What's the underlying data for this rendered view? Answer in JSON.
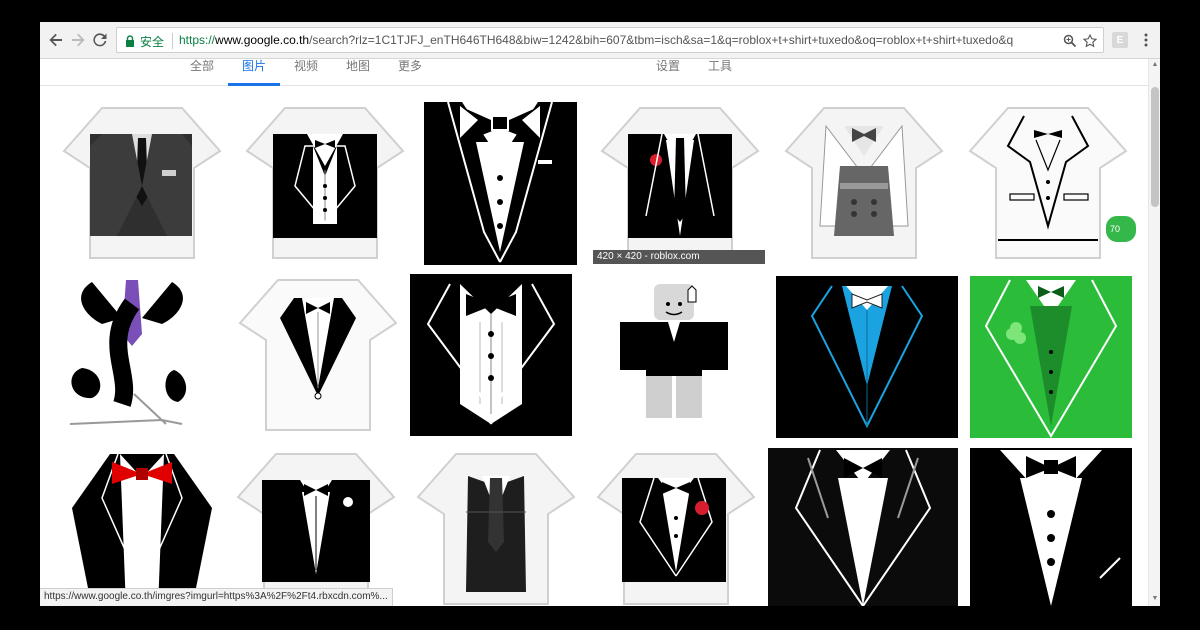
{
  "browser": {
    "secure_label": "安全",
    "url_scheme": "https://",
    "url_host": "www.google.co.th",
    "url_rest": "/search?rlz=1C1TJFJ_enTH646TH648&biw=1242&bih=607&tbm=isch&sa=1&q=roblox+t+shirt+tuxedo&oq=roblox+t+shirt+tuxedo&q",
    "extension_label": "E"
  },
  "search_tabs": [
    {
      "label": "全部",
      "active": false
    },
    {
      "label": "图片",
      "active": true
    },
    {
      "label": "视频",
      "active": false
    },
    {
      "label": "地图",
      "active": false
    },
    {
      "label": "更多",
      "active": false
    },
    {
      "label": "设置",
      "active": false
    },
    {
      "label": "工具",
      "active": false
    }
  ],
  "tooltip": {
    "text": "420 × 420 - roblox.com"
  },
  "status_bar": {
    "text": "https://www.google.co.th/imgres?imgurl=https%3A%2F%2Ft4.rbxcdn.com%..."
  },
  "badge": {
    "text": "70"
  },
  "colors": {
    "secure_green": "#0b8043",
    "active_tab_blue": "#1a73e8",
    "tuxedo_black": "#000000",
    "bow_red": "#e00000",
    "vest_blue": "#1aa3e0",
    "vest_green": "#2bbd3a",
    "badge_green": "#35b84a"
  },
  "icons": [
    "back-arrow-icon",
    "forward-arrow-icon",
    "reload-icon",
    "lock-icon",
    "zoom-icon",
    "star-icon",
    "menu-dots-icon"
  ]
}
